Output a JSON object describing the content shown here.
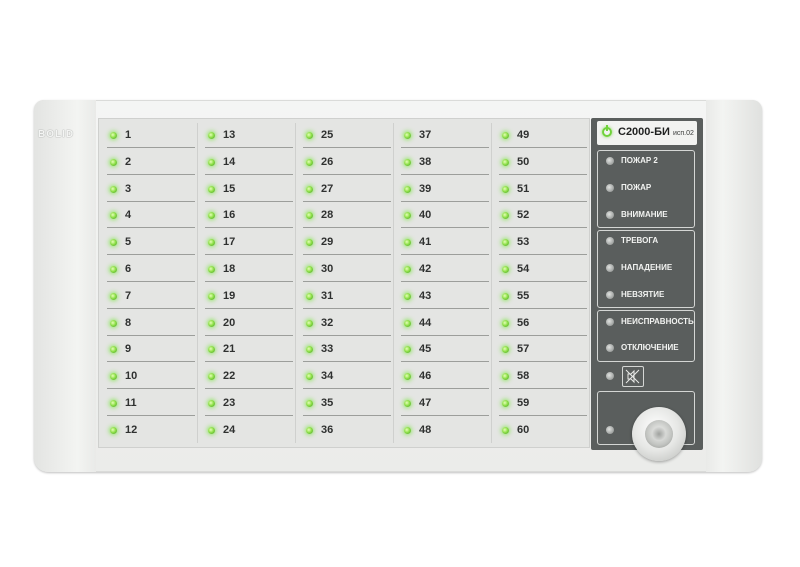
{
  "device": {
    "brand": "BOLID",
    "model": "С2000-БИ",
    "version": "исп.02"
  },
  "zones": [
    [
      "1",
      "2",
      "3",
      "4",
      "5",
      "6",
      "7",
      "8",
      "9",
      "10",
      "11",
      "12"
    ],
    [
      "13",
      "14",
      "15",
      "16",
      "17",
      "18",
      "19",
      "20",
      "21",
      "22",
      "23",
      "24"
    ],
    [
      "25",
      "26",
      "27",
      "28",
      "29",
      "30",
      "31",
      "32",
      "33",
      "34",
      "35",
      "36"
    ],
    [
      "37",
      "38",
      "39",
      "40",
      "41",
      "42",
      "43",
      "44",
      "45",
      "46",
      "47",
      "48"
    ],
    [
      "49",
      "50",
      "51",
      "52",
      "53",
      "54",
      "55",
      "56",
      "57",
      "58",
      "59",
      "60"
    ]
  ],
  "indicators": {
    "fire2": "ПОЖАР 2",
    "fire": "ПОЖАР",
    "attention": "ВНИМАНИЕ",
    "alarm": "ТРЕВОГА",
    "attack": "НАПАДЕНИЕ",
    "not_armed": "НЕВЗЯТИЕ",
    "fault": "НЕИСПРАВНОСТЬ",
    "disabled": "ОТКЛЮЧЕНИЕ"
  },
  "colors": {
    "zone_led": "#8fe04a",
    "status_panel": "#5a5e5d",
    "indicator_led_off": "#a7aaa8"
  },
  "icons": {
    "power": "power-icon",
    "sound_off": "sound-off-icon",
    "key_lock": "key-lock-icon"
  }
}
